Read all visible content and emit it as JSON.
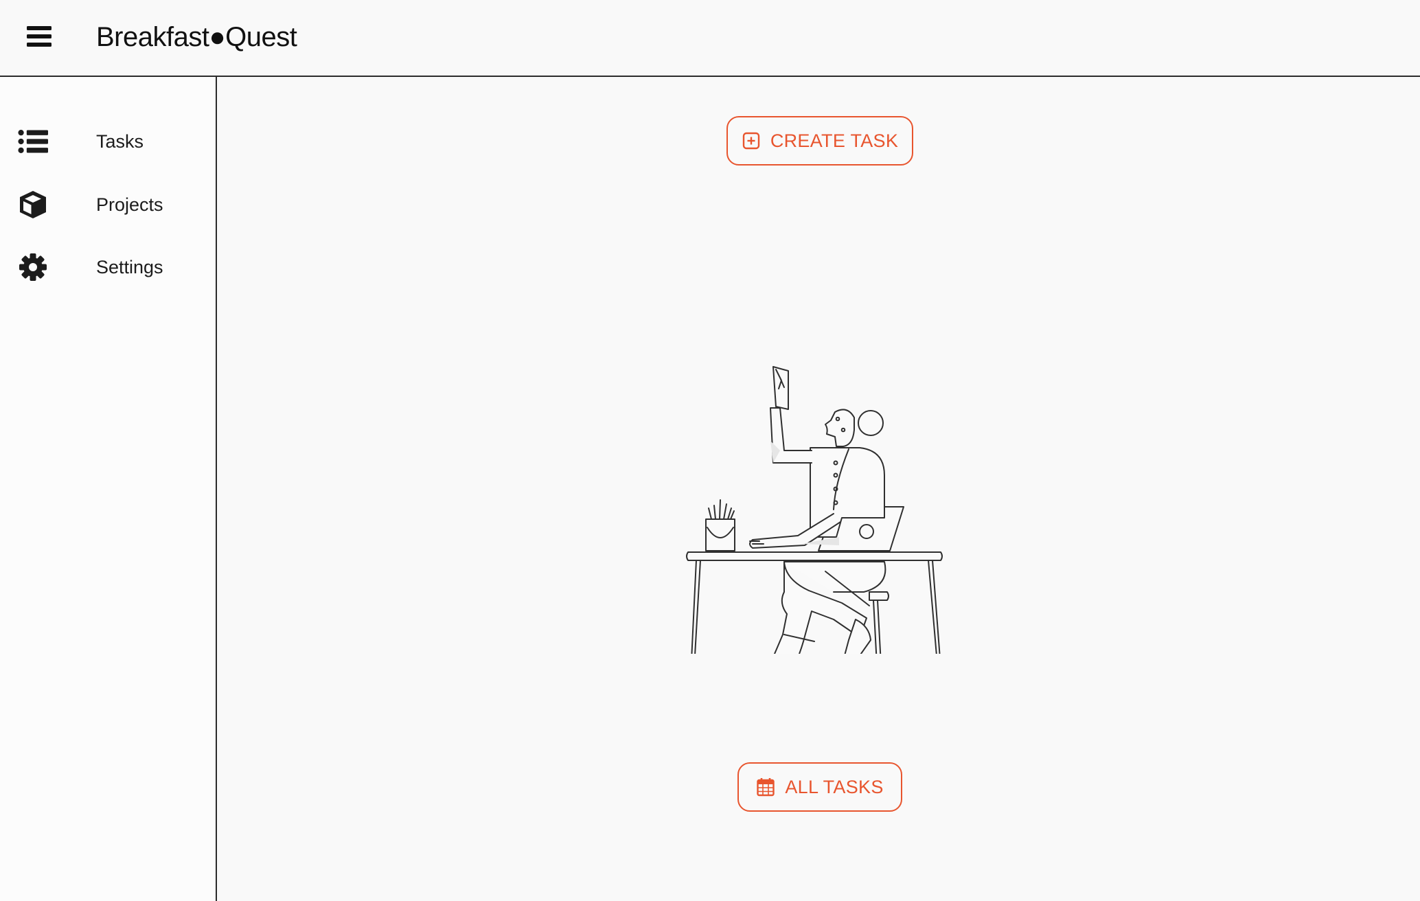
{
  "header": {
    "menu_icon": "hamburger-menu-icon",
    "title": "Breakfast●Quest"
  },
  "sidebar": {
    "items": [
      {
        "label": "Tasks",
        "icon": "list-icon"
      },
      {
        "label": "Projects",
        "icon": "cube-icon"
      },
      {
        "label": "Settings",
        "icon": "gear-icon"
      }
    ]
  },
  "main": {
    "create_task_label": "CREATE TASK",
    "create_task_icon": "plus-square-icon",
    "all_tasks_label": "ALL TASKS",
    "all_tasks_icon": "calendar-icon",
    "illustration": "person-working-at-desk-illustration"
  },
  "colors": {
    "accent": "#e8552e",
    "background": "#f9f9f9",
    "line": "#2a2a2a"
  }
}
